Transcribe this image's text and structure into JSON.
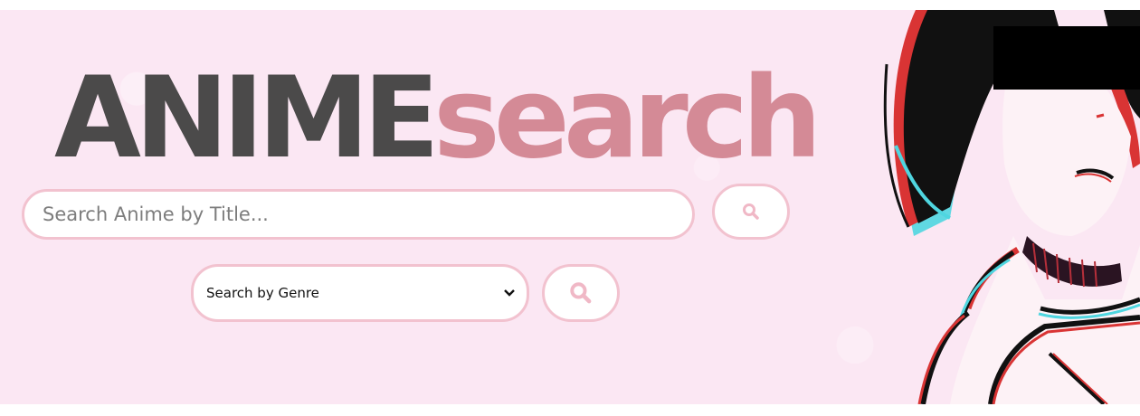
{
  "logo": {
    "part1": "ANIME",
    "part2": "search"
  },
  "search": {
    "title_placeholder": "Search Anime by Title..."
  },
  "genre": {
    "selected": "Search by Genre"
  },
  "icons": {
    "title_search": "search-icon",
    "genre_search": "search-icon",
    "dropdown": "chevron-down-icon"
  },
  "colors": {
    "hero_bg": "#fbe7f3",
    "logo_dark": "#4b4a4a",
    "logo_pink": "#d48a96",
    "accent_border": "#f2c2cf"
  }
}
